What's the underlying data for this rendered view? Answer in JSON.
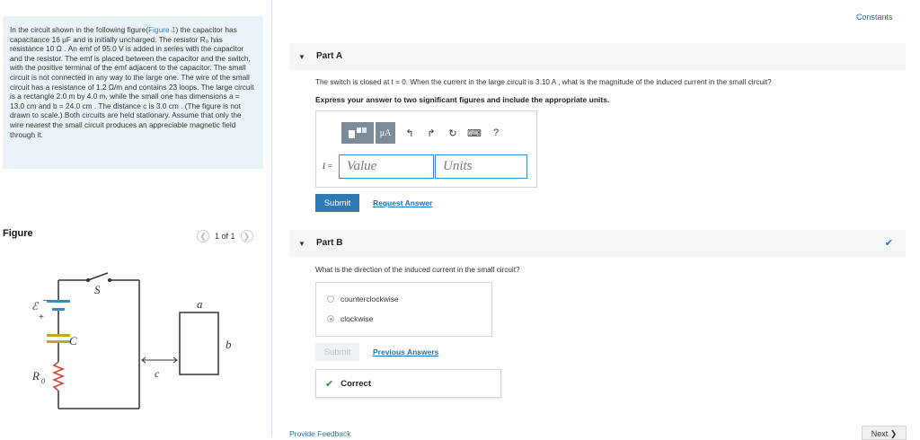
{
  "problem": {
    "text_before_link": "In the circuit shown in the following figure(",
    "figure_link": "Figure 1",
    "text_after_link": ") the capacitor has capacitance 16 μF and is initially uncharged. The resistor R₀ has resistance 10 Ω . An emf of 95.0 V is added in series with the capacitor and the resistor. The emf is placed between the capacitor and the switch, with the positive terminal of the emf adjacent to the capacitor. The small circuit is not connected in any way to the large one. The wire of the small circuit has a resistance of 1.2 Ω/m and contains 23 loops. The large circuit is a rectangle 2.0 m by 4.0 m, while the small one has dimensions a = 13.0 cm and b = 24.0 cm . The distance c is 3.0 cm . (The figure is not drawn to scale.) Both circuits are held stationary. Assume that only the wire nearest the small circuit produces an appreciable magnetic field through it."
  },
  "figure": {
    "title": "Figure",
    "pager": "1 of 1",
    "labels": {
      "switch": "S",
      "emf": "ℰ",
      "minus": "−",
      "plus": "+",
      "capacitor": "C",
      "resistor": "R",
      "resistor_sub": "0",
      "a": "a",
      "b": "b",
      "c": "c"
    }
  },
  "header": {
    "constants_link": "Constants"
  },
  "part_a": {
    "title": "Part A",
    "question": "The switch is closed at t = 0. When the current in the large circuit is 3.10 A , what is the magnitude of the induced current in the small circuit?",
    "instruction": "Express your answer to two significant figures and include the appropriate units.",
    "variable_label": "I =",
    "value_placeholder": "Value",
    "units_placeholder": "Units",
    "toolbar": {
      "mu_label": "μA",
      "help": "?"
    },
    "submit_label": "Submit",
    "request_answer_label": "Request Answer"
  },
  "part_b": {
    "title": "Part B",
    "question": "What is the direction of the induced current in the small circuit?",
    "options": [
      "counterclockwise",
      "clockwise"
    ],
    "selected_option": "clockwise",
    "submit_label": "Submit",
    "previous_answers_label": "Previous Answers",
    "result_label": "Correct"
  },
  "footer": {
    "feedback_link": "Provide Feedback",
    "next_label": "Next ❯"
  },
  "colors": {
    "accent": "#2e7ab6",
    "panel": "#eaf4f8",
    "correct": "#2e8b3a"
  }
}
